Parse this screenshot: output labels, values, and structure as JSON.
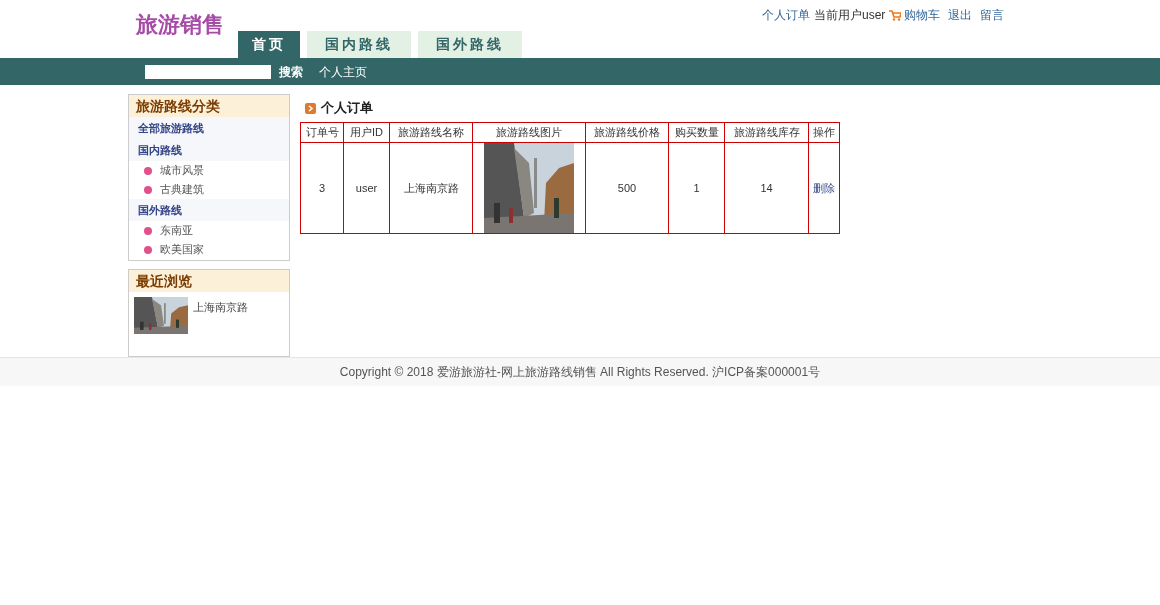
{
  "logo": "旅游销售",
  "top_links": [
    {
      "label": "个人订单",
      "kind": "link"
    },
    {
      "label": "当前用户user",
      "kind": "text"
    },
    {
      "label": "购物车",
      "kind": "cart"
    },
    {
      "label": "退出",
      "kind": "link"
    },
    {
      "label": "留言",
      "kind": "link"
    }
  ],
  "tabs": [
    {
      "label": "首页",
      "selected": true
    },
    {
      "label": "国内路线",
      "selected": false
    },
    {
      "label": "国外路线",
      "selected": false
    }
  ],
  "nav": {
    "search_button": "搜索",
    "home_link": "个人主页"
  },
  "sidebar": {
    "title": "旅游路线分类",
    "items": [
      {
        "label": "全部旅游路线"
      },
      {
        "label": "国内路线",
        "children": [
          {
            "label": "城市风景"
          },
          {
            "label": "古典建筑"
          }
        ]
      },
      {
        "label": "国外路线",
        "children": [
          {
            "label": "东南亚"
          },
          {
            "label": "欧美国家"
          }
        ]
      }
    ]
  },
  "recent": {
    "title": "最近浏览",
    "items": [
      {
        "label": "上海南京路",
        "kind": "picture"
      }
    ]
  },
  "orders": {
    "title": "个人订单",
    "columns": [
      "订单号",
      "用户ID",
      "旅游路线名称",
      "旅游路线图片",
      "旅游路线价格",
      "购买数量",
      "旅游路线库存",
      "操作"
    ],
    "rows": [
      {
        "order": "3",
        "user": "user",
        "name": "上海南京路",
        "price": "500",
        "quantity": "1",
        "stock": "14",
        "action": "删除"
      }
    ]
  },
  "footer": "Copyright © 2018 爱游旅游社-网上旅游路线销售 All Rights Reserved. 沪ICP备案000001号"
}
